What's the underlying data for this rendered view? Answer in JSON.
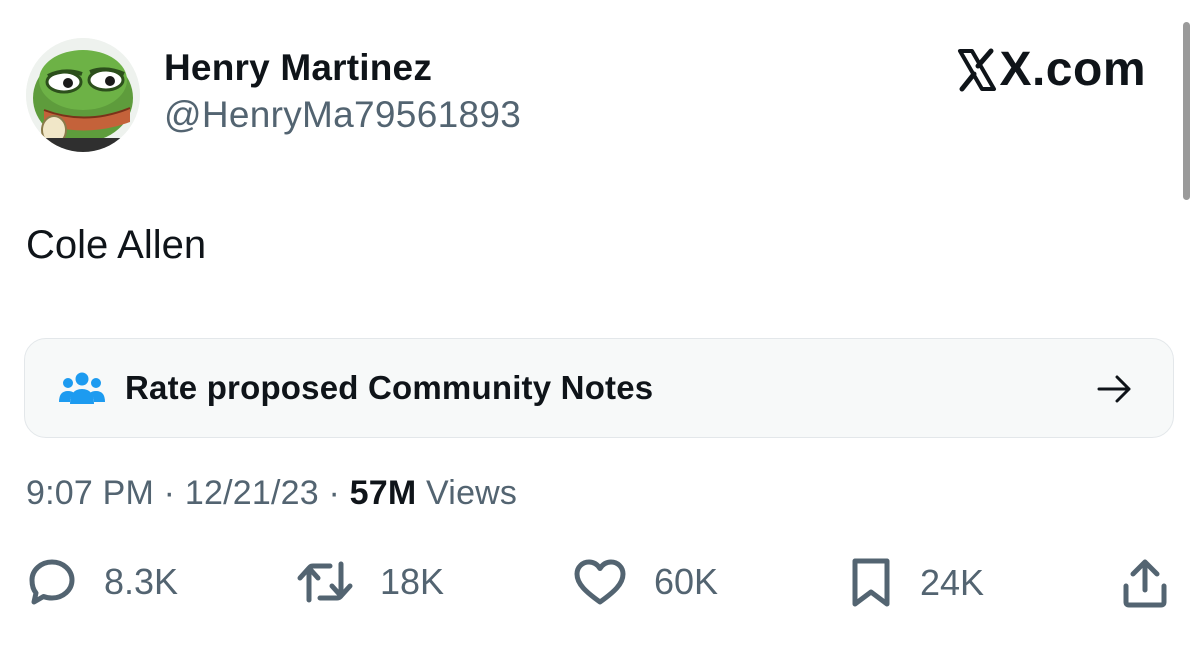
{
  "post": {
    "author": {
      "display_name": "Henry Martinez",
      "handle": "@HenryMa79561893",
      "avatar_icon": "frog-avatar"
    },
    "brand_label": "X.com",
    "text": "Cole Allen",
    "community_notes": {
      "label": "Rate proposed Community Notes",
      "icon": "people-icon",
      "arrow_icon": "arrow-right-icon",
      "accent_color": "#1d9bf0"
    },
    "meta": {
      "time": "9:07 PM",
      "separator": " · ",
      "date": "12/21/23",
      "views_count": "57M",
      "views_label": "Views"
    },
    "actions": {
      "replies": "8.3K",
      "reposts": "18K",
      "likes": "60K",
      "bookmarks": "24K"
    }
  },
  "colors": {
    "text_primary": "#0f1419",
    "text_secondary": "#536471",
    "notes_background": "#f7f9f9"
  }
}
